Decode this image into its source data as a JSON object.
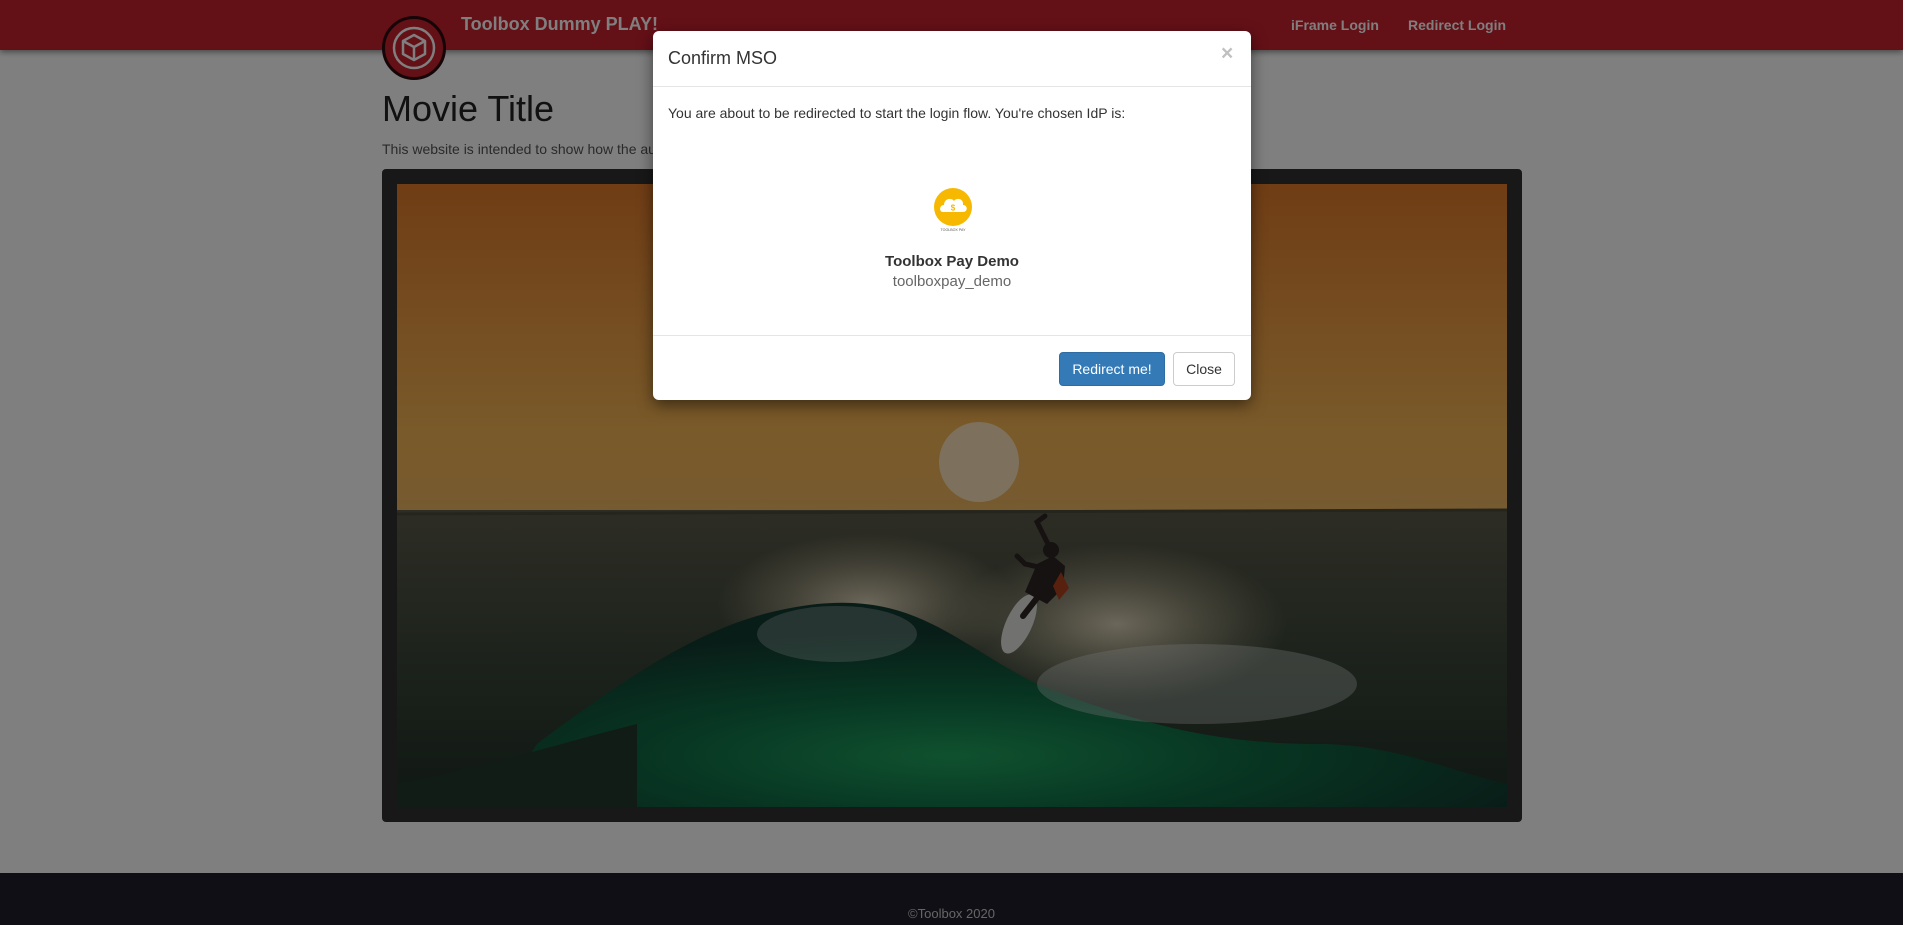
{
  "navbar": {
    "brand": "Toolbox Dummy PLAY!",
    "links": [
      {
        "label": "iFrame Login"
      },
      {
        "label": "Redirect Login"
      }
    ],
    "brand_color": "#c8202f"
  },
  "main": {
    "title": "Movie Title",
    "intro": "This website is intended to show how the au"
  },
  "footer": {
    "copyright": "©Toolbox 2020"
  },
  "modal": {
    "title": "Confirm MSO",
    "close_symbol": "×",
    "message": "You are about to be redirected to start the login flow. You're chosen IdP is:",
    "idp": {
      "logo_caption": "TOOLBOX PAY",
      "name": "Toolbox Pay Demo",
      "id": "toolboxpay_demo",
      "logo_icon": "cloud-dollar-icon"
    },
    "buttons": {
      "redirect": "Redirect me!",
      "close": "Close"
    },
    "accent_color": "#337ab7"
  }
}
